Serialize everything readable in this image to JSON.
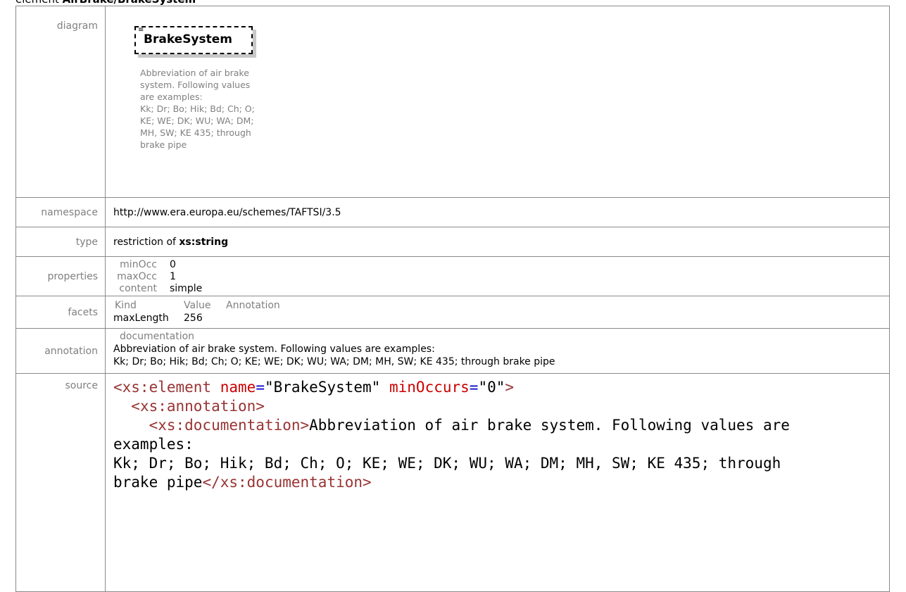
{
  "heading": {
    "prefix": "element",
    "name": "AirBrake/BrakeSystem"
  },
  "rows": {
    "diagram": {
      "label": "diagram",
      "element_name": "BrakeSystem",
      "doc_lines": [
        "Abbreviation of air brake",
        "system. Following values",
        "are examples:",
        "Kk; Dr; Bo; Hik; Bd; Ch; O;",
        "KE; WE; DK; WU; WA; DM;",
        "MH, SW; KE 435; through",
        "brake pipe"
      ]
    },
    "namespace": {
      "label": "namespace",
      "value": "http://www.era.europa.eu/schemes/TAFTSI/3.5"
    },
    "type": {
      "label": "type",
      "prefix": "restriction of ",
      "base": "xs:string"
    },
    "properties": {
      "label": "properties",
      "items": [
        {
          "key": "minOcc",
          "value": "0"
        },
        {
          "key": "maxOcc",
          "value": "1"
        },
        {
          "key": "content",
          "value": "simple"
        }
      ]
    },
    "facets": {
      "label": "facets",
      "headers": [
        "Kind",
        "Value",
        "Annotation"
      ],
      "rows": [
        {
          "kind": "maxLength",
          "value": "256",
          "annotation": ""
        }
      ]
    },
    "annotation": {
      "label": "annotation",
      "title": "documentation",
      "lines": [
        "Abbreviation of air brake system. Following values are examples:",
        "Kk; Dr; Bo; Hik; Bd; Ch; O; KE; WE; DK; WU; WA; DM; MH, SW; KE 435; through brake pipe"
      ]
    },
    "source": {
      "label": "source",
      "line1": {
        "open": "<xs:element",
        "attr1": "name",
        "eq": "=",
        "val1": "\"BrakeSystem\"",
        "attr2": "minOccurs",
        "val2": "\"0\"",
        "close": ">"
      },
      "line2": "<xs:annotation>",
      "line3_tag": "<xs:documentation>",
      "line3_text": "Abbreviation of air brake system. Following values are",
      "line4": "examples:",
      "line5": "Kk; Dr; Bo; Hik; Bd; Ch; O; KE; WE; DK; WU; WA; DM; MH, SW; KE 435; through",
      "line6_text": "brake pipe",
      "line6_tag": "</xs:documentation>"
    }
  }
}
